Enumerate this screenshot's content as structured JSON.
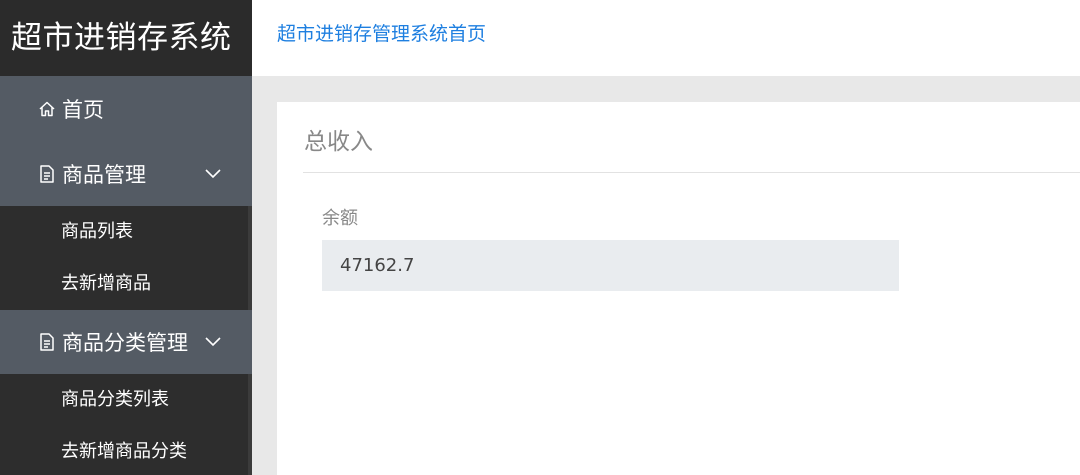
{
  "sidebar": {
    "title": "超市进销存系统",
    "home": {
      "label": "首页",
      "icon": "home-icon"
    },
    "groups": [
      {
        "label": "商品管理",
        "icon": "document-icon",
        "items": [
          {
            "label": "商品列表"
          },
          {
            "label": "去新增商品"
          }
        ]
      },
      {
        "label": "商品分类管理",
        "icon": "document-icon",
        "items": [
          {
            "label": "商品分类列表"
          },
          {
            "label": "去新增商品分类"
          }
        ]
      }
    ]
  },
  "header": {
    "breadcrumb": "超市进销存管理系统首页"
  },
  "main": {
    "card_title": "总收入",
    "field_label": "余额",
    "field_value": "47162.7"
  },
  "colors": {
    "sidebar_bg": "#545b64",
    "sidebar_title_bg": "#2b2b2b",
    "submenu_bg": "#2d2d2d",
    "link": "#1e7fe0",
    "field_bg": "#e9ecef"
  }
}
